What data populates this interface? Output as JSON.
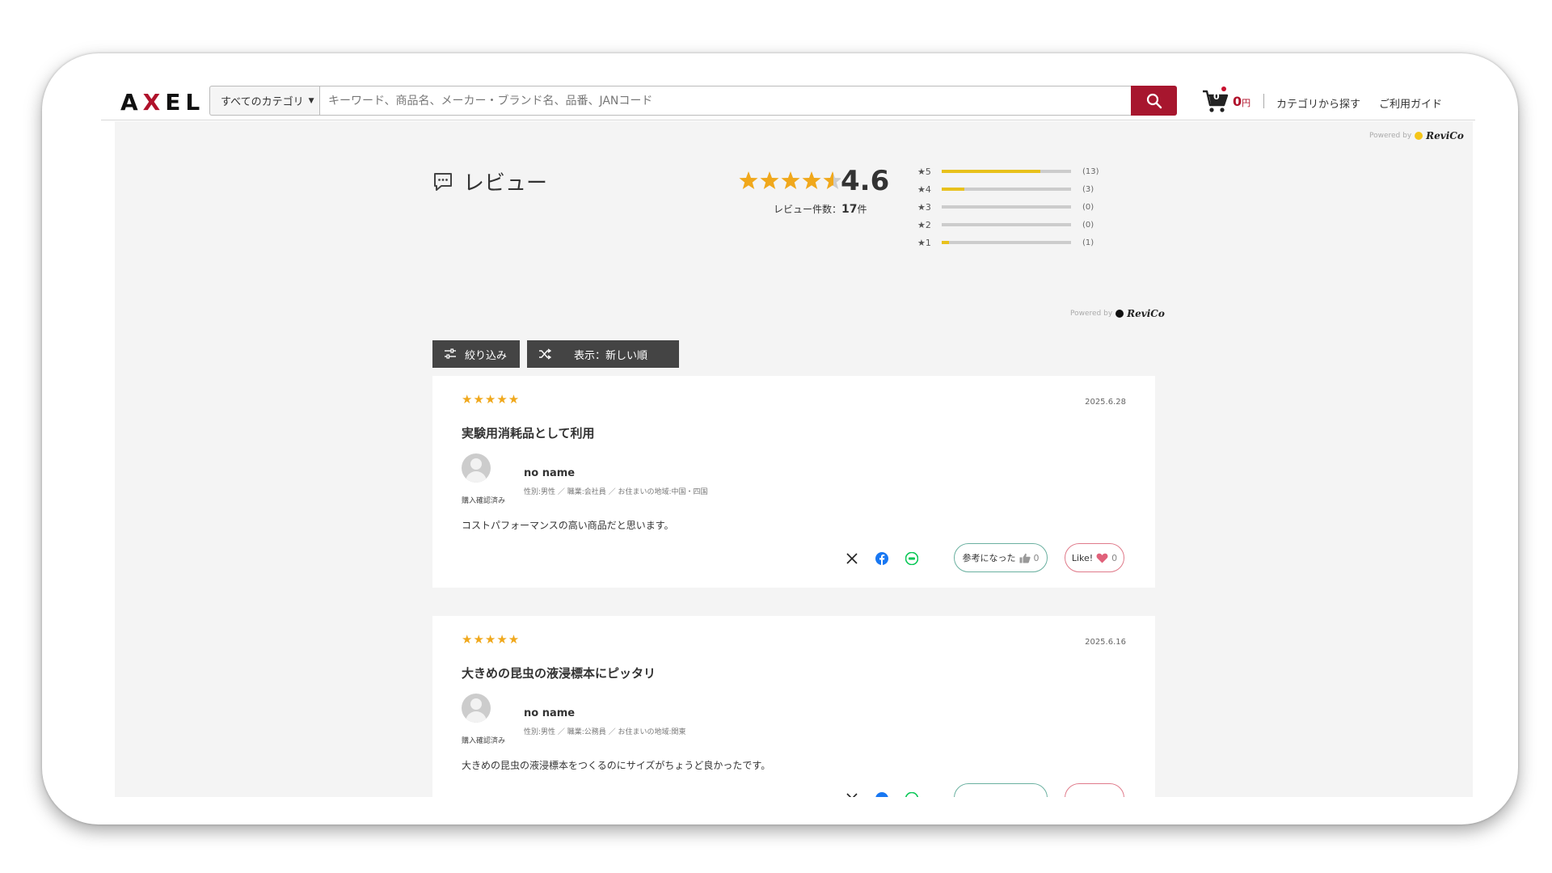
{
  "header": {
    "logo": "AXEL",
    "category_select": "すべてのカテゴリ",
    "search_placeholder": "キーワード、商品名、メーカー・ブランド名、品番、JANコード",
    "cart_count": "0",
    "cart_amount": "0",
    "cart_currency": "円",
    "nav": [
      "カテゴリから探す",
      "ご利用ガイド"
    ]
  },
  "powered_by": {
    "label": "Powered by",
    "brand": "ReviCo"
  },
  "summary": {
    "title": "レビュー",
    "average": "4.6",
    "average_rating": 4.6,
    "count_label": "レビュー件数：",
    "count": "17",
    "count_unit": "件",
    "distribution": [
      {
        "label": "★5",
        "count_label": "(13)",
        "count": 13
      },
      {
        "label": "★4",
        "count_label": "(3)",
        "count": 3
      },
      {
        "label": "★3",
        "count_label": "(0)",
        "count": 0
      },
      {
        "label": "★2",
        "count_label": "(0)",
        "count": 0
      },
      {
        "label": "★1",
        "count_label": "(1)",
        "count": 1
      }
    ]
  },
  "controls": {
    "filter_label": "絞り込み",
    "sort_label": "表示：新しい順"
  },
  "reviews": [
    {
      "rating": 5,
      "date": "2025.6.28",
      "title": "実験用消耗品として利用",
      "name": "no name",
      "attrs": "性別:男性 ／ 職業:会社員 ／ お住まいの地域:中国・四国",
      "verified": "購入確認済み",
      "body": "コストパフォーマンスの高い商品だと思います。",
      "helpful_label": "参考になった",
      "helpful_count": "0",
      "like_label": "Like!",
      "like_count": "0"
    },
    {
      "rating": 5,
      "date": "2025.6.16",
      "title": "大きめの昆虫の液浸標本にピッタリ",
      "name": "no name",
      "attrs": "性別:男性 ／ 職業:公務員 ／ お住まいの地域:関東",
      "verified": "購入確認済み",
      "body": "大きめの昆虫の液浸標本をつくるのにサイズがちょうど良かったです。"
    }
  ],
  "colors": {
    "brand": "#a7162e",
    "star": "#f0a81c",
    "bar": "#e8c11c"
  },
  "icons": [
    "search-icon",
    "cart-icon",
    "comment-icon",
    "filter-icon",
    "shuffle-icon",
    "x-icon",
    "facebook-icon",
    "line-icon",
    "thumbs-up-icon",
    "heart-icon",
    "chevron-up-icon"
  ]
}
